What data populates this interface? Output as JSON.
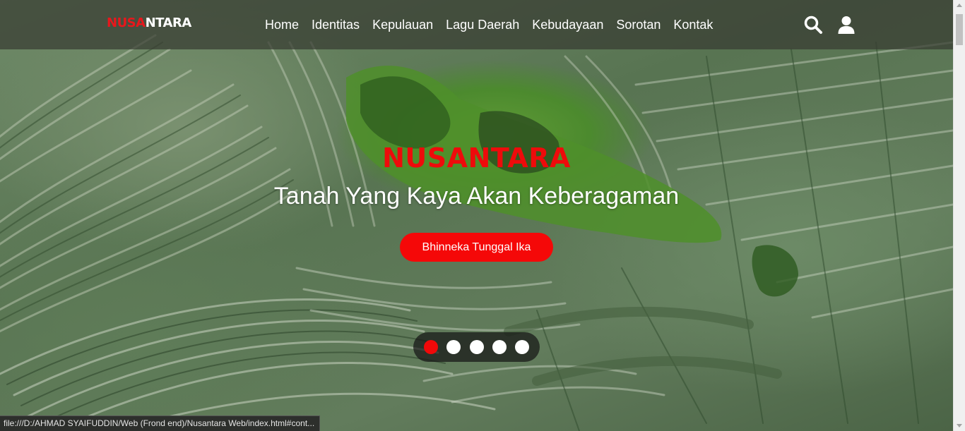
{
  "header": {
    "logo_part1": "NUSA",
    "logo_part2": "NTARA",
    "nav": [
      {
        "label": "Home"
      },
      {
        "label": "Identitas"
      },
      {
        "label": "Kepulauan"
      },
      {
        "label": "Lagu Daerah"
      },
      {
        "label": "Kebudayaan"
      },
      {
        "label": "Sorotan"
      },
      {
        "label": "Kontak"
      }
    ],
    "icons": [
      "search-icon",
      "user-icon"
    ]
  },
  "hero": {
    "title": "NUSANTARA",
    "subtitle": "Tanah Yang Kaya Akan Keberagaman",
    "button_label": "Bhinneka Tunggal Ika"
  },
  "carousel": {
    "slide_count": 5,
    "active_index": 0
  },
  "status_bar": {
    "url": "file:///D:/AHMAD SYAIFUDDIN/Web (Frond end)/Nusantara Web/index.html#cont..."
  },
  "colors": {
    "accent": "#f50808",
    "title_red": "#ee0b0b",
    "navbar": "#373c32",
    "text": "#ffffff"
  }
}
